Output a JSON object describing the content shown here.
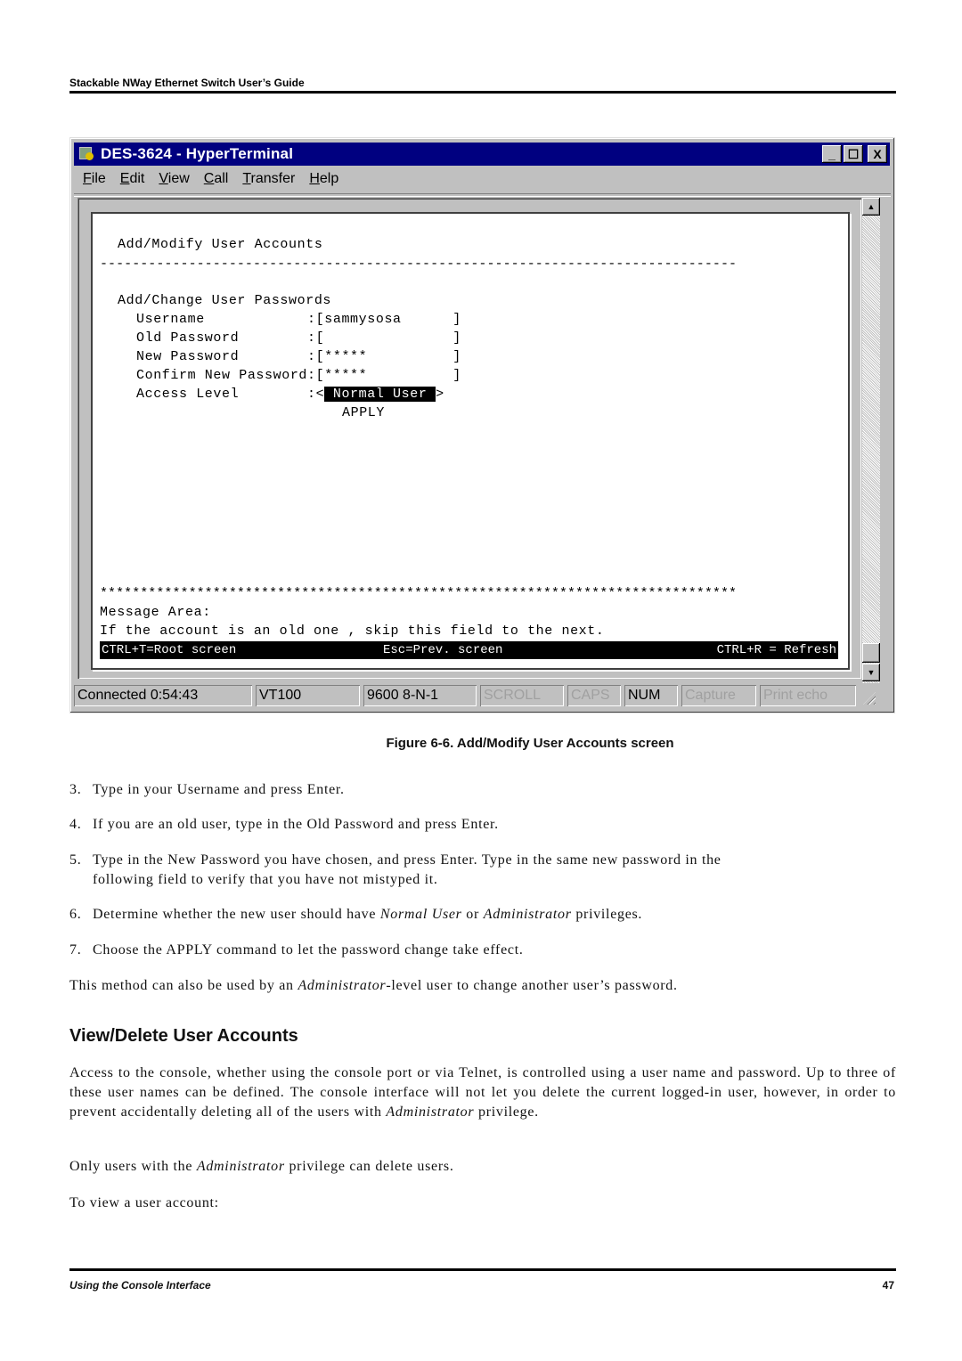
{
  "page": {
    "running_header": "Stackable NWay Ethernet Switch User’s Guide",
    "footer_section": "Using the Console Interface",
    "page_number": "47"
  },
  "window": {
    "title": "DES-3624 - HyperTerminal",
    "icons": {
      "app": "hyperterminal-icon",
      "minimize": "minimize-icon",
      "maximize": "maximize-icon",
      "close": "close-icon"
    },
    "buttons": {
      "minimize": "_",
      "maximize": "☐",
      "close": "X"
    },
    "menu": [
      {
        "label": "File",
        "mnemonic": "F"
      },
      {
        "label": "Edit",
        "mnemonic": "E"
      },
      {
        "label": "View",
        "mnemonic": "V"
      },
      {
        "label": "Call",
        "mnemonic": "C"
      },
      {
        "label": "Transfer",
        "mnemonic": "T"
      },
      {
        "label": "Help",
        "mnemonic": "H"
      }
    ],
    "menu_rest": [
      "ile",
      "dit",
      "iew",
      "all",
      "ransfer",
      "elp"
    ],
    "scroll": {
      "up": "▲",
      "down": "▼"
    }
  },
  "terminal": {
    "screen_title": "Add/Modify User Accounts",
    "dash_rule": "-------------------------------------------------------------------------------",
    "section_title": "Add/Change User Passwords",
    "fields": [
      {
        "label": "Username            ",
        "sep": ":",
        "open": "[",
        "value": "sammysosa",
        "pad": "      ",
        "close": "]"
      },
      {
        "label": "Old Password        ",
        "sep": ":",
        "open": "[",
        "value": "",
        "pad": "               ",
        "close": "]"
      },
      {
        "label": "New Password        ",
        "sep": ":",
        "open": "[",
        "value": "*****",
        "pad": "          ",
        "close": "]"
      },
      {
        "label": "Confirm New Password",
        "sep": ":",
        "open": "[",
        "value": "*****",
        "pad": "          ",
        "close": "]"
      }
    ],
    "access_level": {
      "label": "Access Level        ",
      "sep": ":",
      "open": "<",
      "value": " Normal User ",
      "close": ">"
    },
    "apply_label": "APPLY",
    "star_rule": "*******************************************************************************",
    "message_area_label": "Message Area:",
    "message": "If the account is an old one , skip this field to the next.",
    "hotkeys": {
      "root": "CTRL+T=Root screen",
      "prev": "Esc=Prev. screen",
      "refresh": "CTRL+R = Refresh"
    }
  },
  "statusbar": {
    "connected": "Connected 0:54:43",
    "emulation": "VT100",
    "port_settings": "9600 8-N-1",
    "scroll": "SCROLL",
    "caps": "CAPS",
    "num": "NUM",
    "capture": "Capture",
    "print_echo": "Print echo"
  },
  "figure_caption": "Figure 6-6.  Add/Modify User Accounts screen",
  "steps": [
    {
      "num": "3.",
      "text": "Type in your Username and press Enter."
    },
    {
      "num": "4.",
      "text": "If you are an old user, type in the Old Password and press Enter."
    },
    {
      "num": "5.",
      "text": "Type in the New Password you have chosen, and press Enter. Type in the same new password in the",
      "cont": "following field to verify that you have not mistyped it."
    },
    {
      "num": "6.",
      "pre": "Determine whether the new user should have ",
      "em1": "Normal User",
      "mid": " or ",
      "em2": "Administrator",
      "post": " privileges."
    },
    {
      "num": "7.",
      "text": "Choose the APPLY command to let the password change take effect."
    }
  ],
  "method_note": {
    "pre": "This method can also be used by an ",
    "em": "Administrator",
    "post": "-level user to change another user’s password."
  },
  "section_heading": "View/Delete User Accounts",
  "access_para": {
    "pre": "Access to the console, whether using the console port or via Telnet, is controlled using a user name and password. Up to three of these user names can be defined. The console interface will not let you delete the current logged-in user, however, in order to prevent accidentally deleting all of the users with ",
    "em": "Administrator",
    "post": " privilege."
  },
  "only_para": {
    "pre": "Only users with the ",
    "em": "Administrator",
    "post": " privilege can delete users."
  },
  "view_intro": "To view a user account:"
}
